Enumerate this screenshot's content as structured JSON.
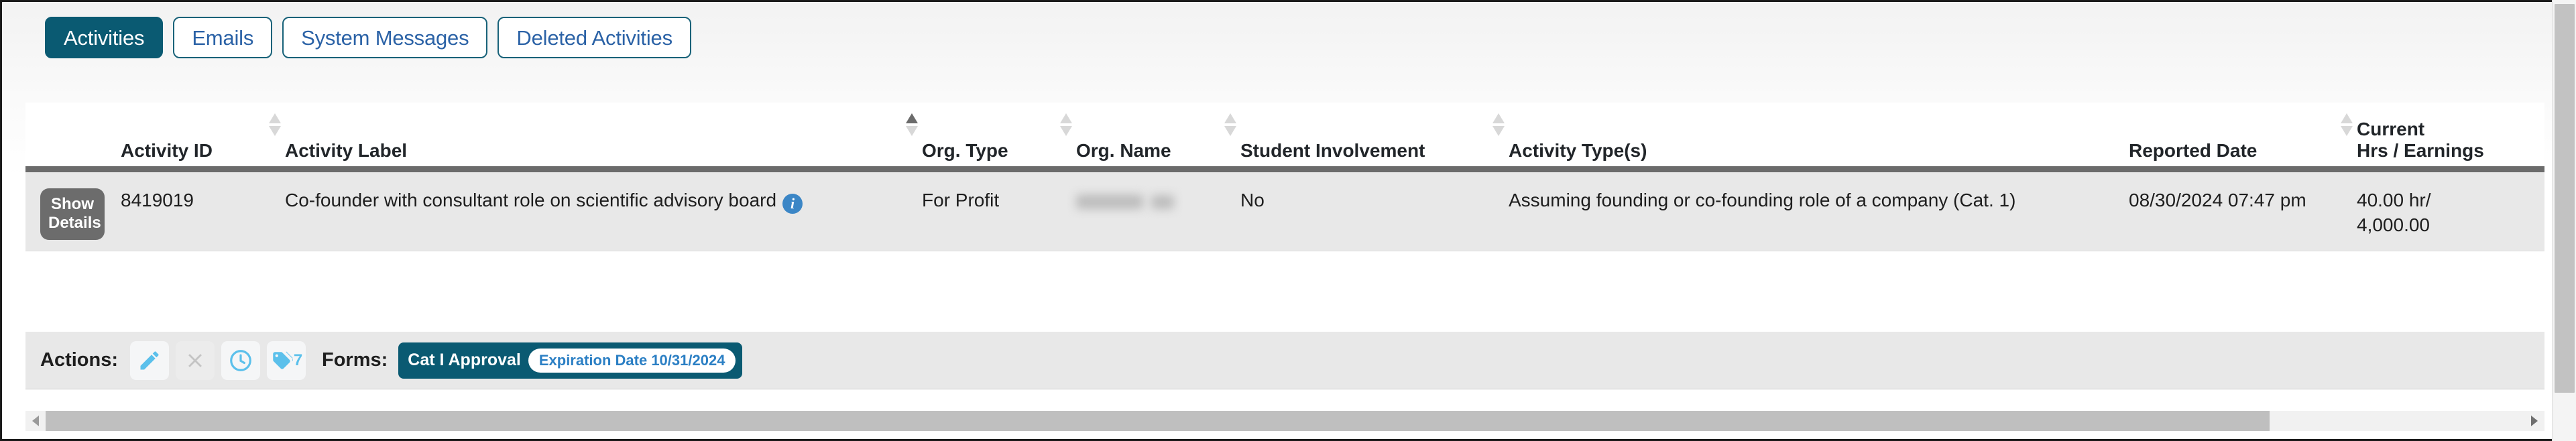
{
  "tabs": [
    {
      "label": "Activities",
      "active": true
    },
    {
      "label": "Emails",
      "active": false
    },
    {
      "label": "System Messages",
      "active": false
    },
    {
      "label": "Deleted Activities",
      "active": false
    }
  ],
  "table": {
    "columns": [
      {
        "key": "actions",
        "label": "",
        "sort": "none"
      },
      {
        "key": "id",
        "label": "Activity ID",
        "sort": "none"
      },
      {
        "key": "label",
        "label": "Activity Label",
        "sort": "asc"
      },
      {
        "key": "org_type",
        "label": "Org. Type",
        "sort": "none"
      },
      {
        "key": "org_name",
        "label": "Org. Name",
        "sort": "none"
      },
      {
        "key": "student",
        "label": "Student Involvement",
        "sort": "none"
      },
      {
        "key": "types",
        "label": "Activity Type(s)",
        "sort": "none"
      },
      {
        "key": "date",
        "label": "Reported Date",
        "sort": "none"
      },
      {
        "key": "hrs_line1",
        "label": "Current",
        "sort": "none"
      },
      {
        "key": "hrs_line2",
        "label": "Hrs / Earnings",
        "sort": "none"
      }
    ],
    "rows": [
      {
        "show_details_line1": "Show",
        "show_details_line2": "Details",
        "activity_id": "8419019",
        "activity_label": "Co-founder with consultant role on scientific advisory board",
        "info_icon": "i",
        "org_type": "For Profit",
        "org_name": "",
        "student_involvement": "No",
        "activity_types": "Assuming founding or co-founding role of a company (Cat. 1)",
        "reported_date": "08/30/2024 07:47 pm",
        "current_hours": "40.00 hr/",
        "current_earnings": "4,000.00"
      }
    ]
  },
  "actions": {
    "label": "Actions:",
    "buttons": [
      {
        "name": "edit",
        "icon": "pencil-icon",
        "disabled": false
      },
      {
        "name": "delete",
        "icon": "close-x-icon",
        "disabled": true
      },
      {
        "name": "history",
        "icon": "clock-icon",
        "disabled": false
      },
      {
        "name": "tags",
        "icon": "tags-icon",
        "disabled": false,
        "count": "7"
      }
    ]
  },
  "forms": {
    "label": "Forms:",
    "items": [
      {
        "name": "Cat I Approval",
        "expiration": "Expiration Date 10/31/2024"
      }
    ]
  },
  "colors": {
    "accent_teal": "#0a5a72",
    "link_blue": "#2b62a6",
    "icon_blue": "#5bc0eb",
    "row_bg": "#e8e8e8",
    "header_rule": "#6b6b6b",
    "info_blue": "#3b86c6",
    "show_details_bg": "#6c6c6c"
  }
}
